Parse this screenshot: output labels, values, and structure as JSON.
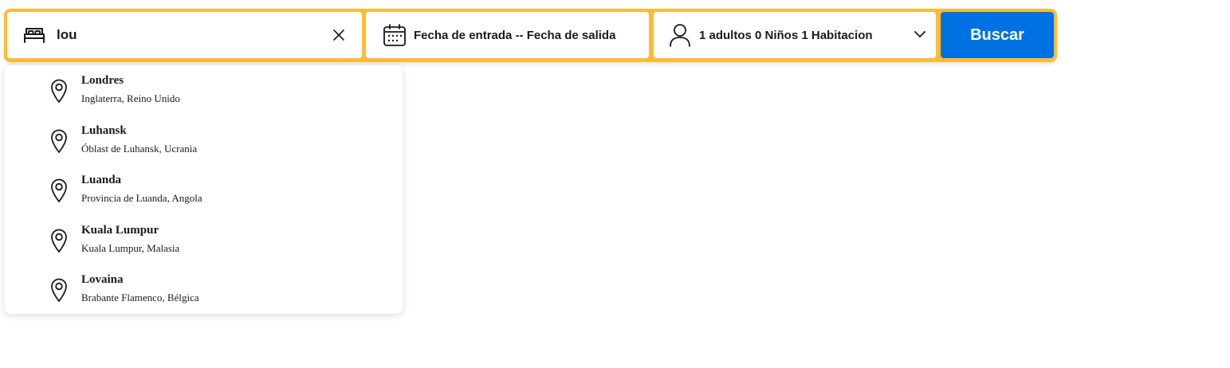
{
  "search": {
    "destination_value": "lou",
    "dates_label": "Fecha de entrada -- Fecha de salida",
    "guests_label": "1 adultos 0 Niños 1 Habitacion",
    "button_label": "Buscar"
  },
  "suggestions": [
    {
      "name": "Londres",
      "region": "Inglaterra, Reino Unido"
    },
    {
      "name": "Luhansk",
      "region": "Óblast de Luhansk, Ucrania"
    },
    {
      "name": "Luanda",
      "region": "Provincia de Luanda, Angola"
    },
    {
      "name": "Kuala Lumpur",
      "region": "Kuala Lumpur, Malasia"
    },
    {
      "name": "Lovaina",
      "region": "Brabante Flamenco, Bélgica"
    }
  ],
  "colors": {
    "border_accent": "#febb35",
    "button_blue": "#0071e2"
  },
  "icons": {
    "destination": "bed-icon",
    "clear": "close-icon",
    "dates": "calendar-icon",
    "guests": "person-icon",
    "expand": "chevron-down-icon",
    "suggestion": "map-pin-icon"
  }
}
